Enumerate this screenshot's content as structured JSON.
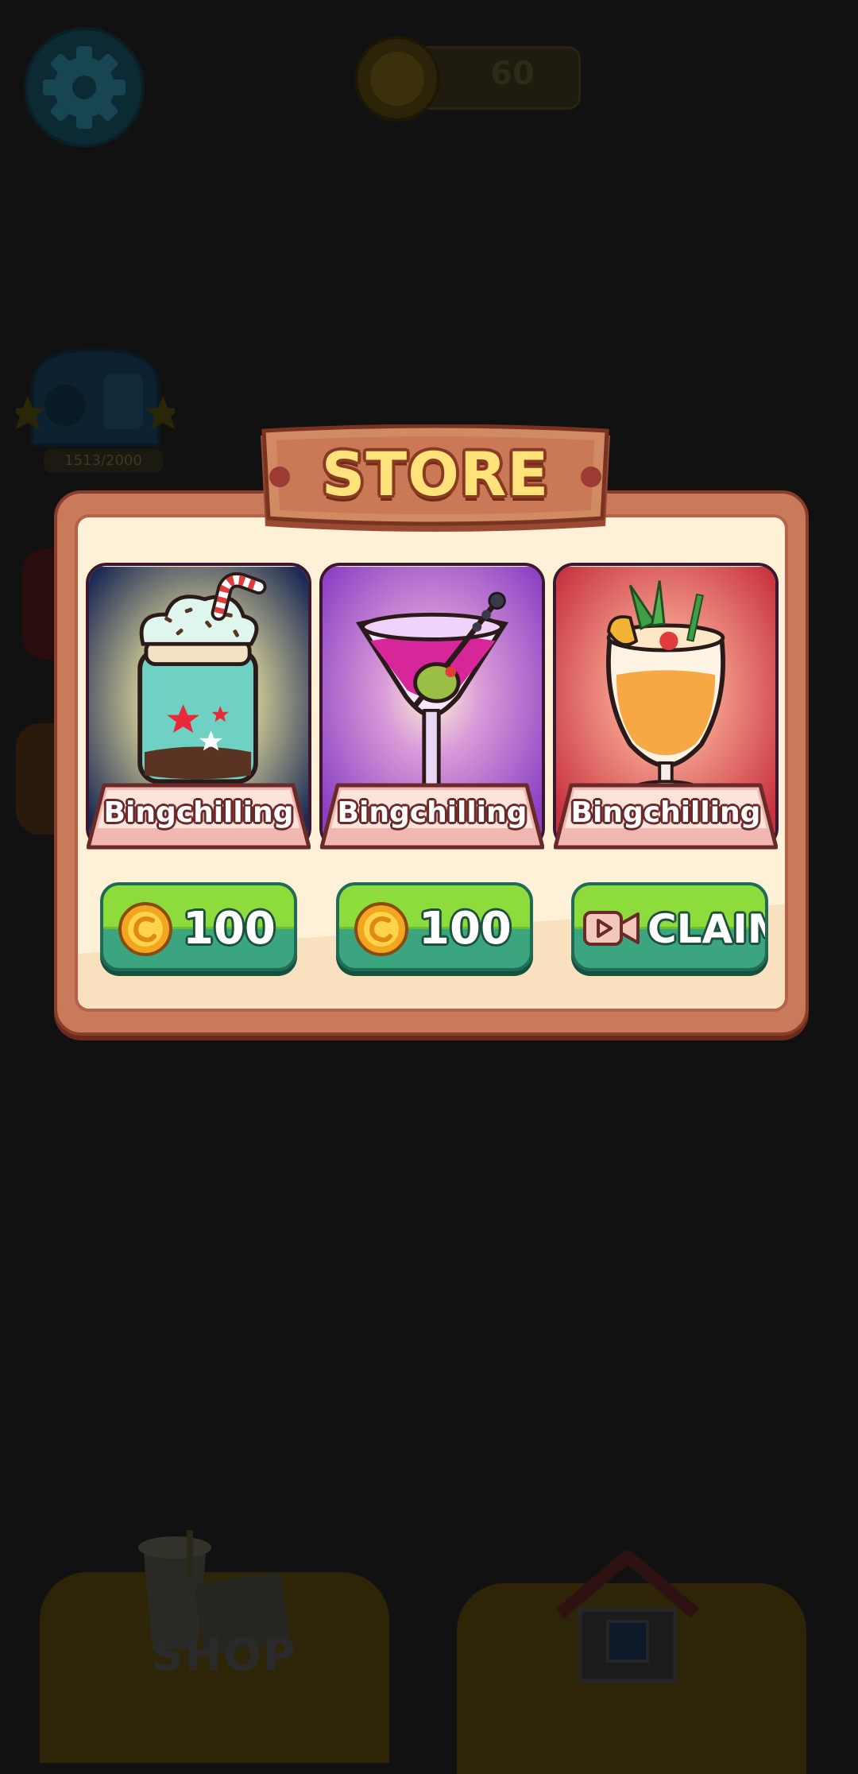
{
  "hud": {
    "coin_amount": "60",
    "machine_progress": "1513/2000"
  },
  "bottom_nav": {
    "shop_label": "SHOP"
  },
  "store": {
    "title": "STORE",
    "items": [
      {
        "name": "Bingchilling",
        "price": "100",
        "price_type": "coin",
        "art": "milkshake-jar"
      },
      {
        "name": "Bingchilling",
        "price": "100",
        "price_type": "coin",
        "art": "martini-glass"
      },
      {
        "name": "Bingchilling",
        "price": "CLAIM",
        "price_type": "video-ad",
        "art": "tropical-cocktail"
      }
    ]
  },
  "colors": {
    "dialog_frame": "#c97a5b",
    "dialog_inner": "#fff1d8",
    "title_text": "#ffe27a",
    "button_top": "#8ddc3c",
    "button_bottom": "#3aa57f",
    "card_1_bg": "#1d2a55",
    "card_2_bg": "#8a3fc4",
    "card_3_bg": "#c8323e"
  }
}
